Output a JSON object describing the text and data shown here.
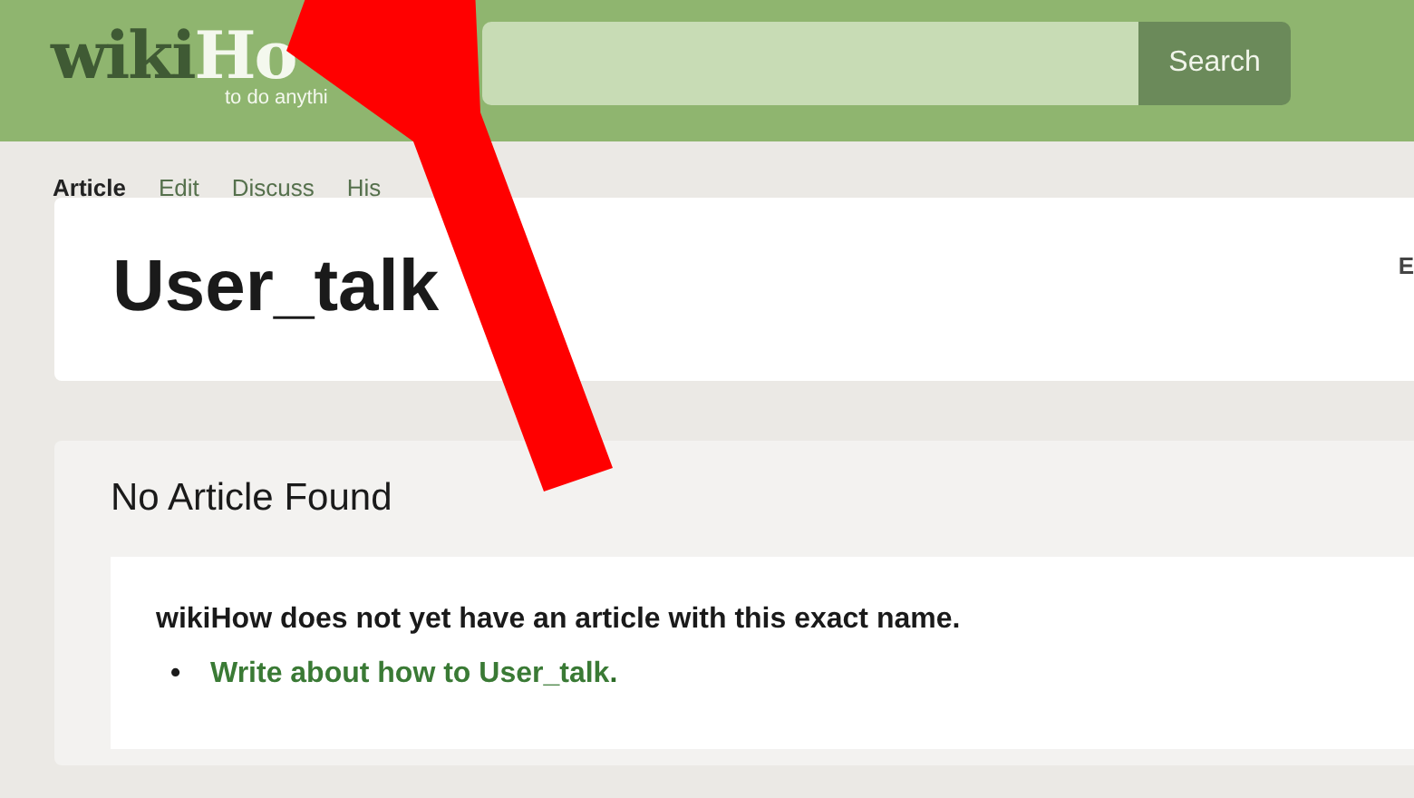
{
  "header": {
    "logo_dark": "wiki",
    "logo_light": "Ho",
    "tagline": "to do anythi",
    "search": {
      "button": "Search"
    }
  },
  "tabs": [
    {
      "label": "Article",
      "selected": true
    },
    {
      "label": "Edit",
      "selected": false
    },
    {
      "label": "Discuss",
      "selected": false
    },
    {
      "label": "His",
      "selected": false
    }
  ],
  "page": {
    "title": "User_talk",
    "side_link": "E"
  },
  "notice": {
    "heading": "No Article Found",
    "message": "wikiHow does not yet have an article with this exact name.",
    "links": [
      {
        "marker": "•",
        "text": "Write about how to User_talk",
        "after": "."
      }
    ]
  }
}
